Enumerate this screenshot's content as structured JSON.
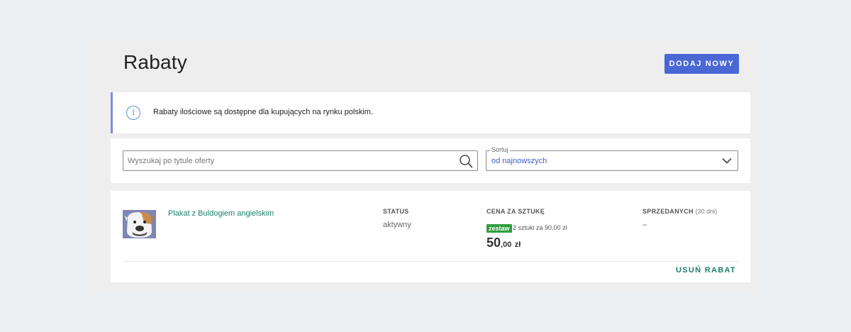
{
  "header": {
    "title": "Rabaty",
    "add_label": "DODAJ NOWY"
  },
  "info": {
    "icon": "info-icon",
    "text": "Rabaty ilościowe są dostępne dla kupujących na rynku polskim."
  },
  "filters": {
    "search_placeholder": "Wyszukaj po tytule oferty",
    "search_icon": "search-icon",
    "sort_label": "Sortuj",
    "sort_value": "od najnowszych"
  },
  "discounts": [
    {
      "title": "Plakat z Buldogiem angielskim",
      "status_header": "STATUS",
      "status": "aktywny",
      "price_header": "CENA ZA SZTUKĘ",
      "badge": "zestaw",
      "offer": "2 sztuki za 90,00 zł",
      "price_main": "50",
      "price_decimals": ",00",
      "currency": "zł",
      "sold_header": "SPRZEDANYCH",
      "sold_period": "(30 dni)",
      "sold": "–",
      "remove_label": "USUŃ RABAT"
    }
  ],
  "colors": {
    "accent": "#4a67d6",
    "link": "#1b7f6a",
    "badge": "#2f9e3e",
    "info_border": "#7b8de0"
  }
}
